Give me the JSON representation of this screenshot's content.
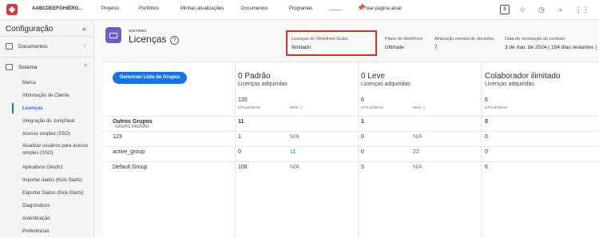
{
  "topbar": {
    "org_name": "AABCDEEFGHIÉRG...",
    "nav": [
      "Projetos",
      "Portfólios",
      "Minhas atualizações",
      "Documentos",
      "Programas"
    ],
    "pin_label": "Fixar página atual",
    "notification_count": "0"
  },
  "sidebar": {
    "title": "Configuração",
    "sections": [
      "Documentos",
      "Sistema"
    ],
    "items": [
      "Marca",
      "Informação de Cliente",
      "Licenças",
      "Integração do JumpSeat",
      "Acesso simples (SSO)",
      "Atualizar usuários para acesso",
      "simples (SSO)",
      "Aplicativos OAuth2",
      "Importar dados (Kick-Starts)",
      "Exportar Dados (Kick-Starts)",
      "Diagnósticos",
      "Autenticação",
      "Preferências"
    ]
  },
  "header": {
    "kicker": "SISTEMA",
    "title": "Licenças",
    "info": [
      {
        "label": "Licenças do Workfront Goals",
        "value": "Ilimitado"
      },
      {
        "label": "Plano do Workfront",
        "value": "Ultimate"
      },
      {
        "label": "Atribuição mensal de decisões",
        "value": "7"
      },
      {
        "label": "Data de renovação do contrato",
        "value": "3 de mar. de 2024 ( 194 dias restantes )"
      }
    ]
  },
  "table": {
    "button_label": "Gerenciar Lista de Grupos",
    "group_col_caption": "GRUPO PADRÃO",
    "columns": [
      {
        "title": "0 Padrão",
        "subtitle": "Licenças adquiridas",
        "used": "120",
        "used_cap": "UTILIZADAS",
        "max_cap": "MAX ⓘ"
      },
      {
        "title": "0 Leve",
        "subtitle": "Licenças adquiridas",
        "used": "6",
        "used_cap": "UTILIZADAS",
        "max_cap": "MAX ⓘ"
      },
      {
        "title": "Colaborador ilimitado",
        "subtitle": "Licenças adquiridas",
        "used": "6",
        "used_cap": "UTILIZADAS"
      }
    ],
    "rows": [
      {
        "name": "Outros Grupos",
        "p_used": "11",
        "p_max": "",
        "l_used": "1",
        "l_max": "",
        "c_used": "0"
      },
      {
        "name": "123",
        "p_used": "1",
        "p_max": "N/A",
        "l_used": "0",
        "l_max": "N/A",
        "c_used": "0"
      },
      {
        "name": "active_group",
        "p_used": "0",
        "p_max": "11",
        "l_used": "0",
        "l_max": "22",
        "c_used": "0"
      },
      {
        "name": "Default Group",
        "p_used": "108",
        "p_max": "N/A",
        "l_used": "5",
        "l_max": "N/A",
        "c_used": "6"
      }
    ]
  },
  "colors": {
    "accent": "#1473e6",
    "highlight": "#d93025",
    "system_icon": "#6a5fcb"
  }
}
